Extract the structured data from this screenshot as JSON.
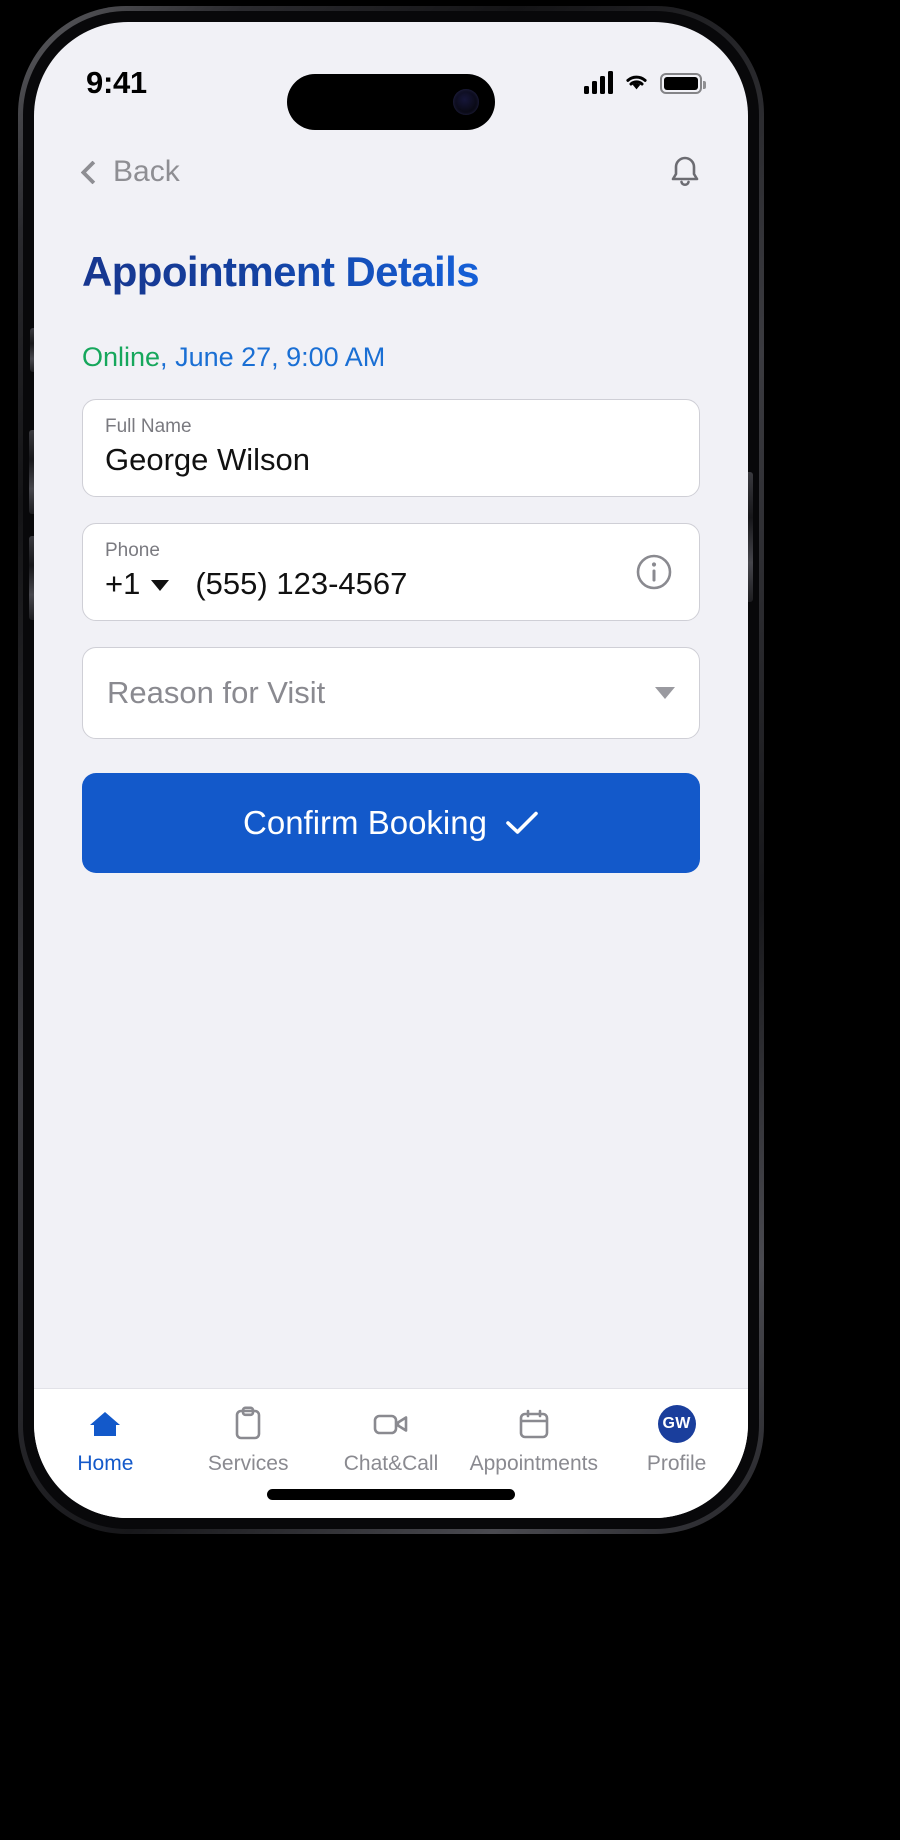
{
  "status_bar": {
    "time": "9:41",
    "signal_icon": "cellular-signal-icon",
    "wifi_icon": "wifi-icon",
    "battery_icon": "battery-full-icon"
  },
  "nav": {
    "back_label": "Back",
    "back_icon": "chevron-left-icon",
    "notification_icon": "bell-icon"
  },
  "header": {
    "title": "Appointment Details",
    "title_gradient_from": "#17368f",
    "title_gradient_to": "#1560d8"
  },
  "summary": {
    "mode": "Online",
    "mode_color": "#16a75c",
    "separator": ", ",
    "when": "June 27, 9:00 AM",
    "when_color": "#1a6fd4",
    "full_text": "Online, June 27, 9:00 AM"
  },
  "form": {
    "full_name": {
      "label": "Full Name",
      "value": "George Wilson"
    },
    "phone": {
      "label": "Phone",
      "country_code": "+1",
      "country_caret_icon": "chevron-down-icon",
      "number": "(555) 123-4567",
      "info_icon": "info-circle-icon"
    },
    "reason": {
      "placeholder": "Reason for Visit",
      "value": "",
      "caret_icon": "chevron-down-icon"
    },
    "confirm": {
      "label": "Confirm Booking",
      "icon": "check-icon",
      "color": "#1359ca"
    }
  },
  "tab_bar": {
    "active_color": "#1359ca",
    "inactive_color": "#8a8a90",
    "items": [
      {
        "label": "Home",
        "icon": "home-icon",
        "active": true
      },
      {
        "label": "Services",
        "icon": "clipboard-icon",
        "active": false
      },
      {
        "label": "Chat&Call",
        "icon": "video-camera-icon",
        "active": false
      },
      {
        "label": "Appointments",
        "icon": "calendar-icon",
        "active": false
      },
      {
        "label": "Profile",
        "icon": "avatar-icon",
        "active": false,
        "avatar_initials": "GW"
      }
    ]
  }
}
